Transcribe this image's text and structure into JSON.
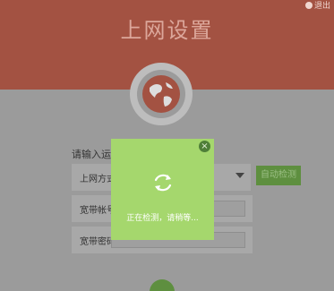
{
  "header": {
    "title": "上网设置",
    "exit_label": "退出"
  },
  "form": {
    "hint": "请输入运营",
    "connection_type_label": "上网方式",
    "detect_button_label": "自动检测",
    "account_label": "宽带帐号",
    "password_label": "宽带密码"
  },
  "modal": {
    "status_text": "正在检测，请稍等...",
    "close_symbol": "×"
  },
  "colors": {
    "header": "#a35242",
    "accent_green": "#a5d76d",
    "overlay_gray": "#9b9b9b"
  },
  "icons": [
    "globe-icon",
    "refresh-spinner-icon",
    "close-icon",
    "chevron-down-icon",
    "exit-icon"
  ]
}
